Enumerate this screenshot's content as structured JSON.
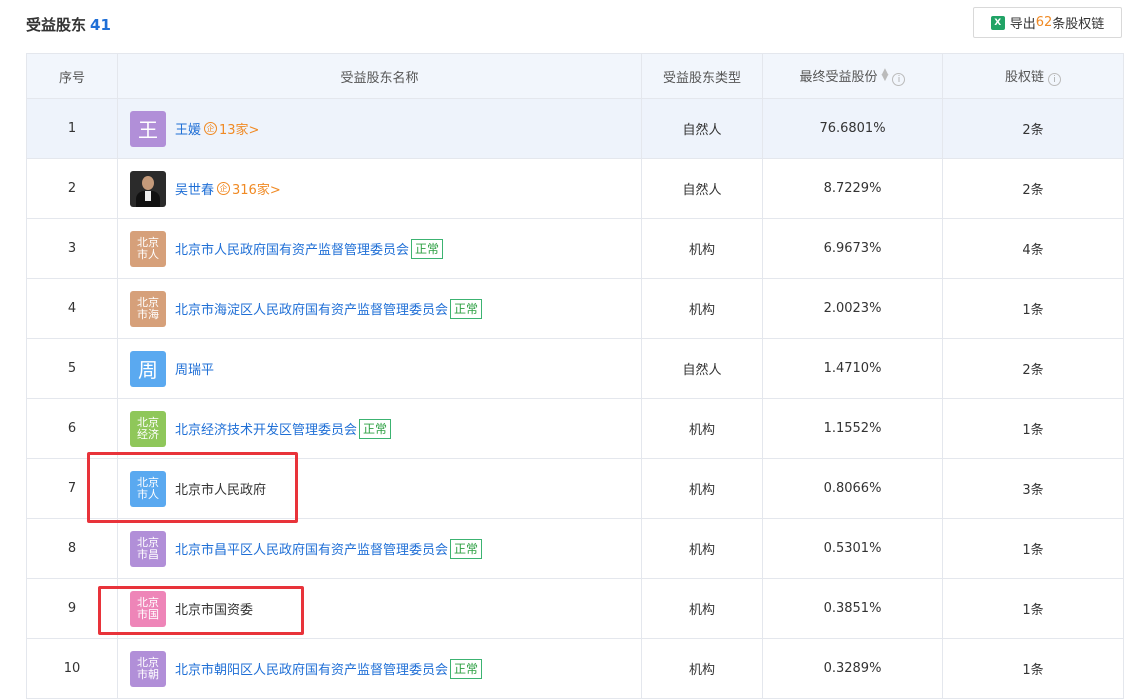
{
  "header": {
    "title": "受益股东",
    "count": "41",
    "export": {
      "prefix": "导出",
      "num": "62",
      "suffix": "条股权链"
    }
  },
  "table": {
    "columns": [
      "序号",
      "受益股东名称",
      "受益股东类型",
      "最终受益股份",
      "股权链"
    ],
    "rows": [
      {
        "idx": "1",
        "avatar": "王",
        "avatar_color": "#b18fd8",
        "name": "王媛",
        "holdings": "13家>",
        "type": "自然人",
        "share": "76.6801%",
        "chain": "2条"
      },
      {
        "idx": "2",
        "avatar": "photo",
        "name": "吴世春",
        "holdings": "316家>",
        "type": "自然人",
        "share": "8.7229%",
        "chain": "2条"
      },
      {
        "idx": "3",
        "avatar_top": "北京",
        "avatar_bottom": "市人",
        "avatar_color": "#d6a07a",
        "name": "北京市人民政府国有资产监督管理委员会",
        "status": "正常",
        "type": "机构",
        "share": "6.9673%",
        "chain": "4条"
      },
      {
        "idx": "4",
        "avatar_top": "北京",
        "avatar_bottom": "市海",
        "avatar_color": "#d6a07a",
        "name": "北京市海淀区人民政府国有资产监督管理委员会",
        "status": "正常",
        "type": "机构",
        "share": "2.0023%",
        "chain": "1条"
      },
      {
        "idx": "5",
        "avatar": "周",
        "avatar_color": "#5aa9f0",
        "name": "周瑞平",
        "type": "自然人",
        "share": "1.4710%",
        "chain": "2条"
      },
      {
        "idx": "6",
        "avatar_top": "北京",
        "avatar_bottom": "经济",
        "avatar_color": "#8fc75a",
        "name": "北京经济技术开发区管理委员会",
        "status": "正常",
        "type": "机构",
        "share": "1.1552%",
        "chain": "1条"
      },
      {
        "idx": "7",
        "avatar_top": "北京",
        "avatar_bottom": "市人",
        "avatar_color": "#5aa9f0",
        "name": "北京市人民政府",
        "type": "机构",
        "share": "0.8066%",
        "chain": "3条"
      },
      {
        "idx": "8",
        "avatar_top": "北京",
        "avatar_bottom": "市昌",
        "avatar_color": "#b18fd8",
        "name": "北京市昌平区人民政府国有资产监督管理委员会",
        "status": "正常",
        "type": "机构",
        "share": "0.5301%",
        "chain": "1条"
      },
      {
        "idx": "9",
        "avatar_top": "北京",
        "avatar_bottom": "市国",
        "avatar_color": "#ee85b8",
        "name": "北京市国资委",
        "type": "机构",
        "share": "0.3851%",
        "chain": "1条"
      },
      {
        "idx": "10",
        "avatar_top": "北京",
        "avatar_bottom": "市朝",
        "avatar_color": "#b18fd8",
        "name": "北京市朝阳区人民政府国有资产监督管理委员会",
        "status": "正常",
        "type": "机构",
        "share": "0.3289%",
        "chain": "1条"
      }
    ]
  },
  "colors": {
    "link": "#1f6fd6",
    "accent": "#f08a24",
    "status": "#2ea043",
    "highlight_box": "#e8333a"
  }
}
